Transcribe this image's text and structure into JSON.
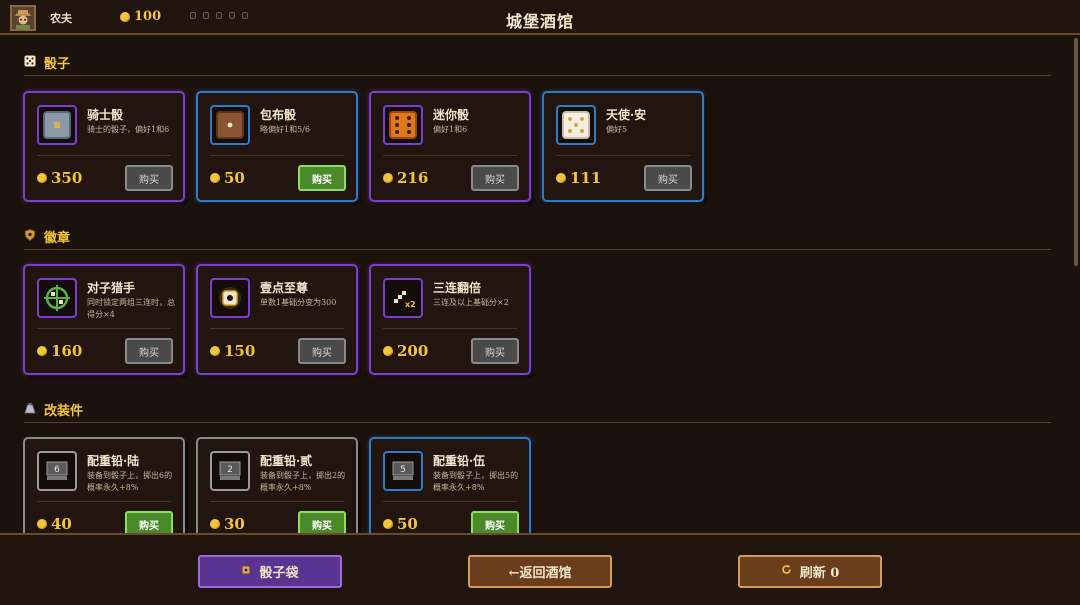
{
  "header": {
    "title": "城堡酒馆",
    "player_name": "农夫",
    "gold": "100",
    "avatar_icon": "farmer-portrait-icon",
    "empty_slots": 5
  },
  "sections": [
    {
      "label": "骰子",
      "icon": "dice-icon",
      "items": [
        {
          "name": "骑士骰",
          "desc": "骑士的骰子，偏好1和6",
          "price": "350",
          "buy_label": "购买",
          "can_buy": false,
          "rarity": "purple",
          "icon": "knight-die-icon"
        },
        {
          "name": "包布骰",
          "desc": "略偏好1和5/6",
          "price": "50",
          "buy_label": "购买",
          "can_buy": true,
          "rarity": "blue",
          "icon": "cloth-die-icon"
        },
        {
          "name": "迷你骰",
          "desc": "偏好1和6",
          "price": "216",
          "buy_label": "购买",
          "can_buy": false,
          "rarity": "purple",
          "icon": "mini-die-icon"
        },
        {
          "name": "天使·安",
          "desc": "偏好5",
          "price": "111",
          "buy_label": "购买",
          "can_buy": false,
          "rarity": "blue",
          "icon": "angel-die-icon"
        }
      ]
    },
    {
      "label": "徽章",
      "icon": "badge-icon",
      "items": [
        {
          "name": "对子猎手",
          "desc": "同时锁定两组三连时，总得分×4",
          "price": "160",
          "buy_label": "购买",
          "can_buy": false,
          "rarity": "purple",
          "icon": "crosshair-icon"
        },
        {
          "name": "壹点至尊",
          "desc": "单数1基础分变为300",
          "price": "150",
          "buy_label": "购买",
          "can_buy": false,
          "rarity": "purple",
          "icon": "one-pip-icon"
        },
        {
          "name": "三连翻倍",
          "desc": "三连及以上基础分×2",
          "price": "200",
          "buy_label": "购买",
          "can_buy": false,
          "rarity": "purple",
          "icon": "stairs-x2-icon"
        }
      ]
    },
    {
      "label": "改装件",
      "icon": "weight-icon",
      "items": [
        {
          "name": "配重铅·陆",
          "desc": "装备到骰子上，掷出6的概率永久+8%",
          "price": "40",
          "buy_label": "购买",
          "can_buy": true,
          "rarity": "gray",
          "icon": "weight-6-icon",
          "face": "6"
        },
        {
          "name": "配重铅·贰",
          "desc": "装备到骰子上，掷出2的概率永久+8%",
          "price": "30",
          "buy_label": "购买",
          "can_buy": true,
          "rarity": "gray",
          "icon": "weight-2-icon",
          "face": "2"
        },
        {
          "name": "配重铅·伍",
          "desc": "装备到骰子上，掷出5的概率永久+8%",
          "price": "50",
          "buy_label": "购买",
          "can_buy": true,
          "rarity": "blue",
          "icon": "weight-5-icon",
          "face": "5"
        }
      ]
    }
  ],
  "footer": {
    "bag_label": "骰子袋",
    "back_label": "←返回酒馆",
    "refresh_label": "刷新 0"
  },
  "colors": {
    "gold": "#f3c53a",
    "purple": "#7a3fd0",
    "blue": "#2e7cc8",
    "gray": "#8a8a8a",
    "buy_enabled": "#4a8a2a"
  }
}
